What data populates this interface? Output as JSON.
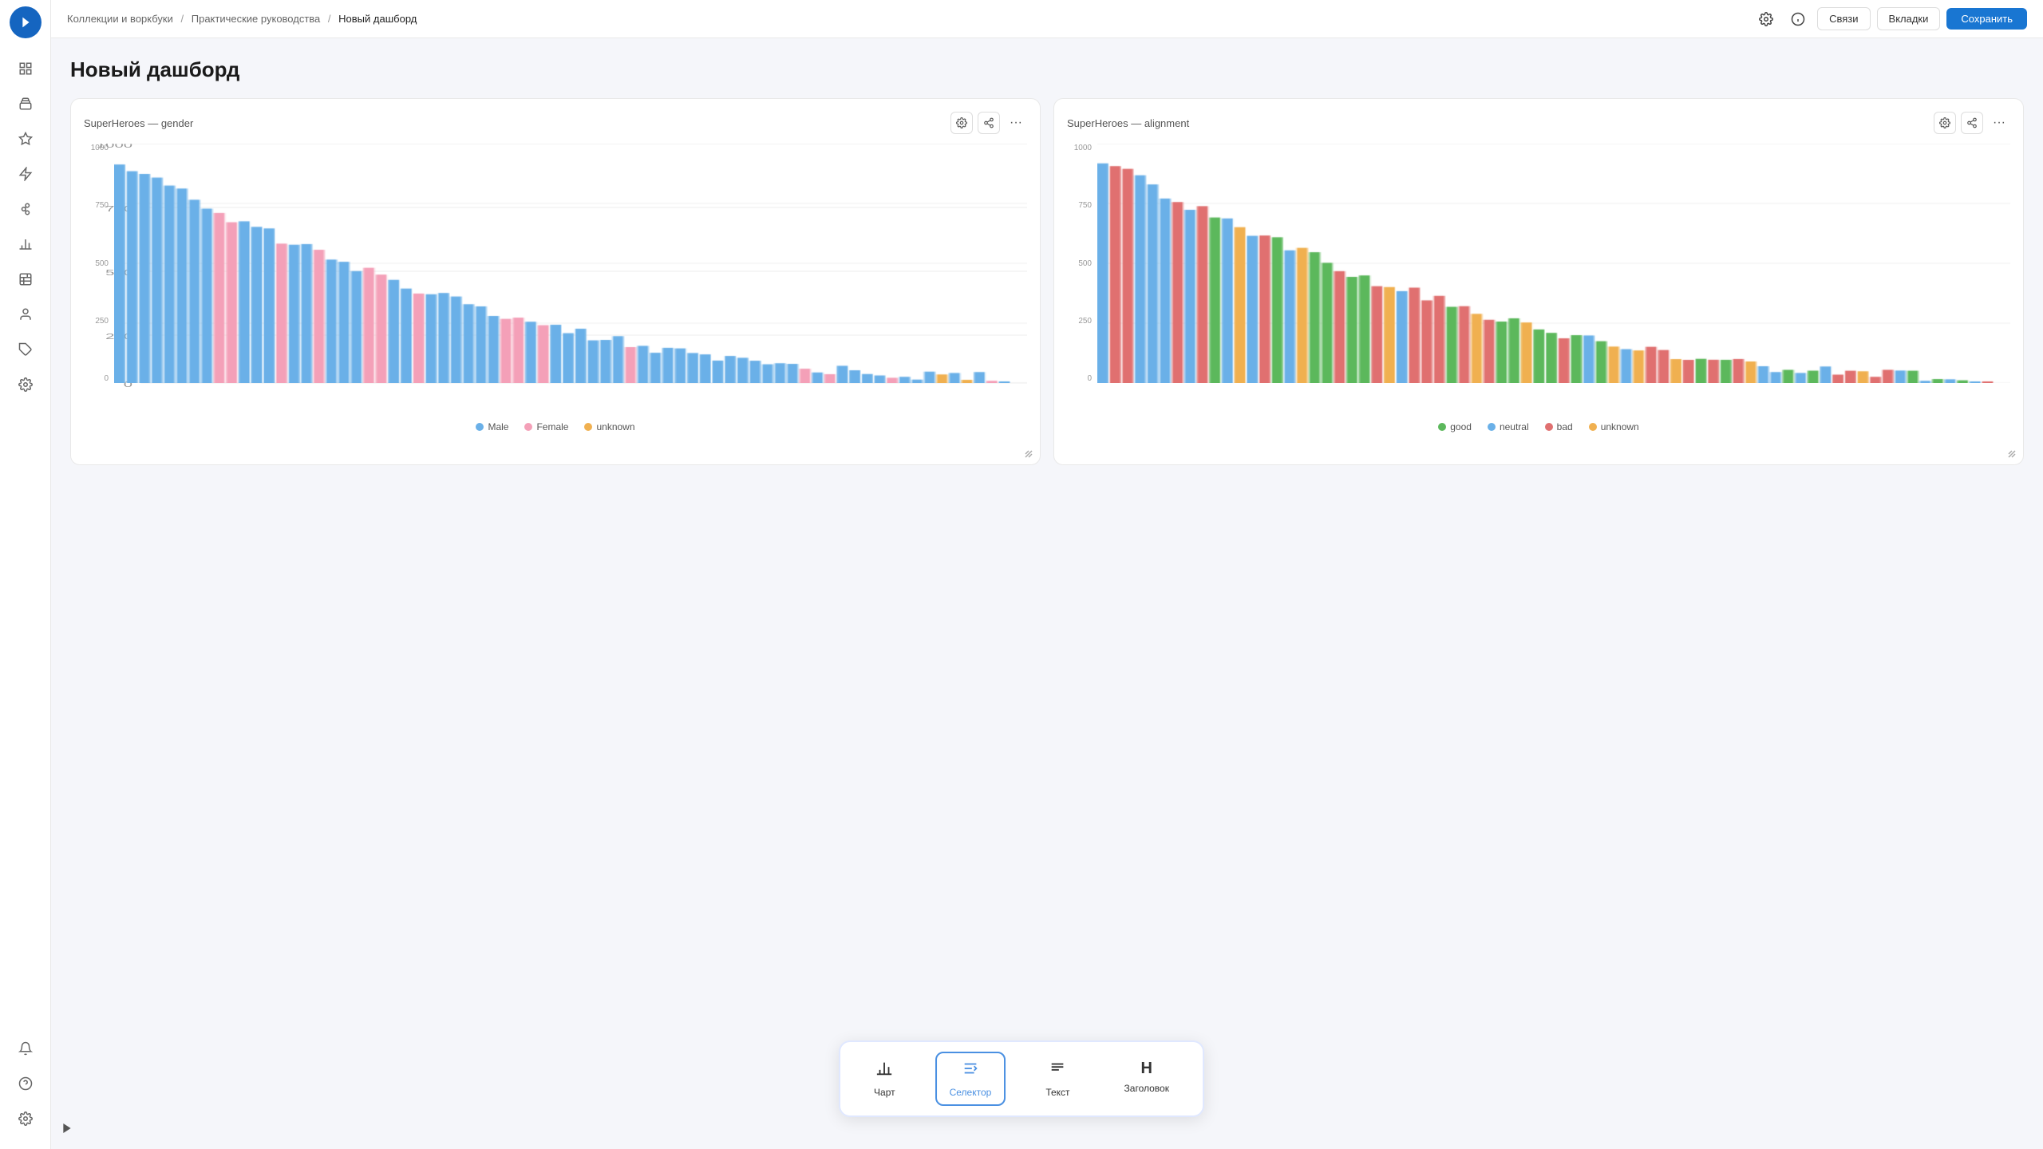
{
  "breadcrumb": {
    "part1": "Коллекции и воркбуки",
    "part2": "Практические руководства",
    "part3": "Новый дашборд"
  },
  "topbar": {
    "settings_label": "Связи",
    "tabs_label": "Вкладки",
    "save_label": "Сохранить"
  },
  "page": {
    "title": "Новый дашборд"
  },
  "charts": [
    {
      "id": "gender",
      "title": "SuperHeroes — gender",
      "legend": [
        {
          "label": "Male",
          "color": "#6ab0e8"
        },
        {
          "label": "Female",
          "color": "#f4a0b8"
        },
        {
          "label": "unknown",
          "color": "#f0b050"
        }
      ],
      "y_labels": [
        "1000",
        "750",
        "500",
        "250",
        "0"
      ]
    },
    {
      "id": "alignment",
      "title": "SuperHeroes — alignment",
      "legend": [
        {
          "label": "good",
          "color": "#5cb85c"
        },
        {
          "label": "neutral",
          "color": "#6ab0e8"
        },
        {
          "label": "bad",
          "color": "#e07070"
        },
        {
          "label": "unknown",
          "color": "#f0b050"
        }
      ],
      "y_labels": [
        "1000",
        "750",
        "500",
        "250",
        "0"
      ]
    }
  ],
  "widget_bar": {
    "items": [
      {
        "id": "chart",
        "icon": "chart",
        "label": "Чарт",
        "active": false
      },
      {
        "id": "selector",
        "icon": "selector",
        "label": "Селектор",
        "active": true
      },
      {
        "id": "text",
        "icon": "text",
        "label": "Текст",
        "active": false
      },
      {
        "id": "heading",
        "icon": "heading",
        "label": "Заголовок",
        "active": false
      }
    ]
  },
  "sidebar": {
    "logo_icon": "arrow-right-icon",
    "items": [
      {
        "id": "grid",
        "icon": "grid-icon"
      },
      {
        "id": "collection",
        "icon": "collection-icon"
      },
      {
        "id": "star",
        "icon": "star-icon"
      },
      {
        "id": "lightning",
        "icon": "lightning-icon"
      },
      {
        "id": "links",
        "icon": "links-icon"
      },
      {
        "id": "bar-chart",
        "icon": "bar-chart-icon"
      },
      {
        "id": "table-plus",
        "icon": "table-plus-icon"
      },
      {
        "id": "person",
        "icon": "person-icon"
      },
      {
        "id": "tag",
        "icon": "tag-icon"
      },
      {
        "id": "settings-gear",
        "icon": "settings-gear-icon"
      }
    ],
    "bottom_items": [
      {
        "id": "bell",
        "icon": "bell-icon"
      },
      {
        "id": "help",
        "icon": "help-icon"
      },
      {
        "id": "settings",
        "icon": "settings-icon"
      }
    ]
  }
}
